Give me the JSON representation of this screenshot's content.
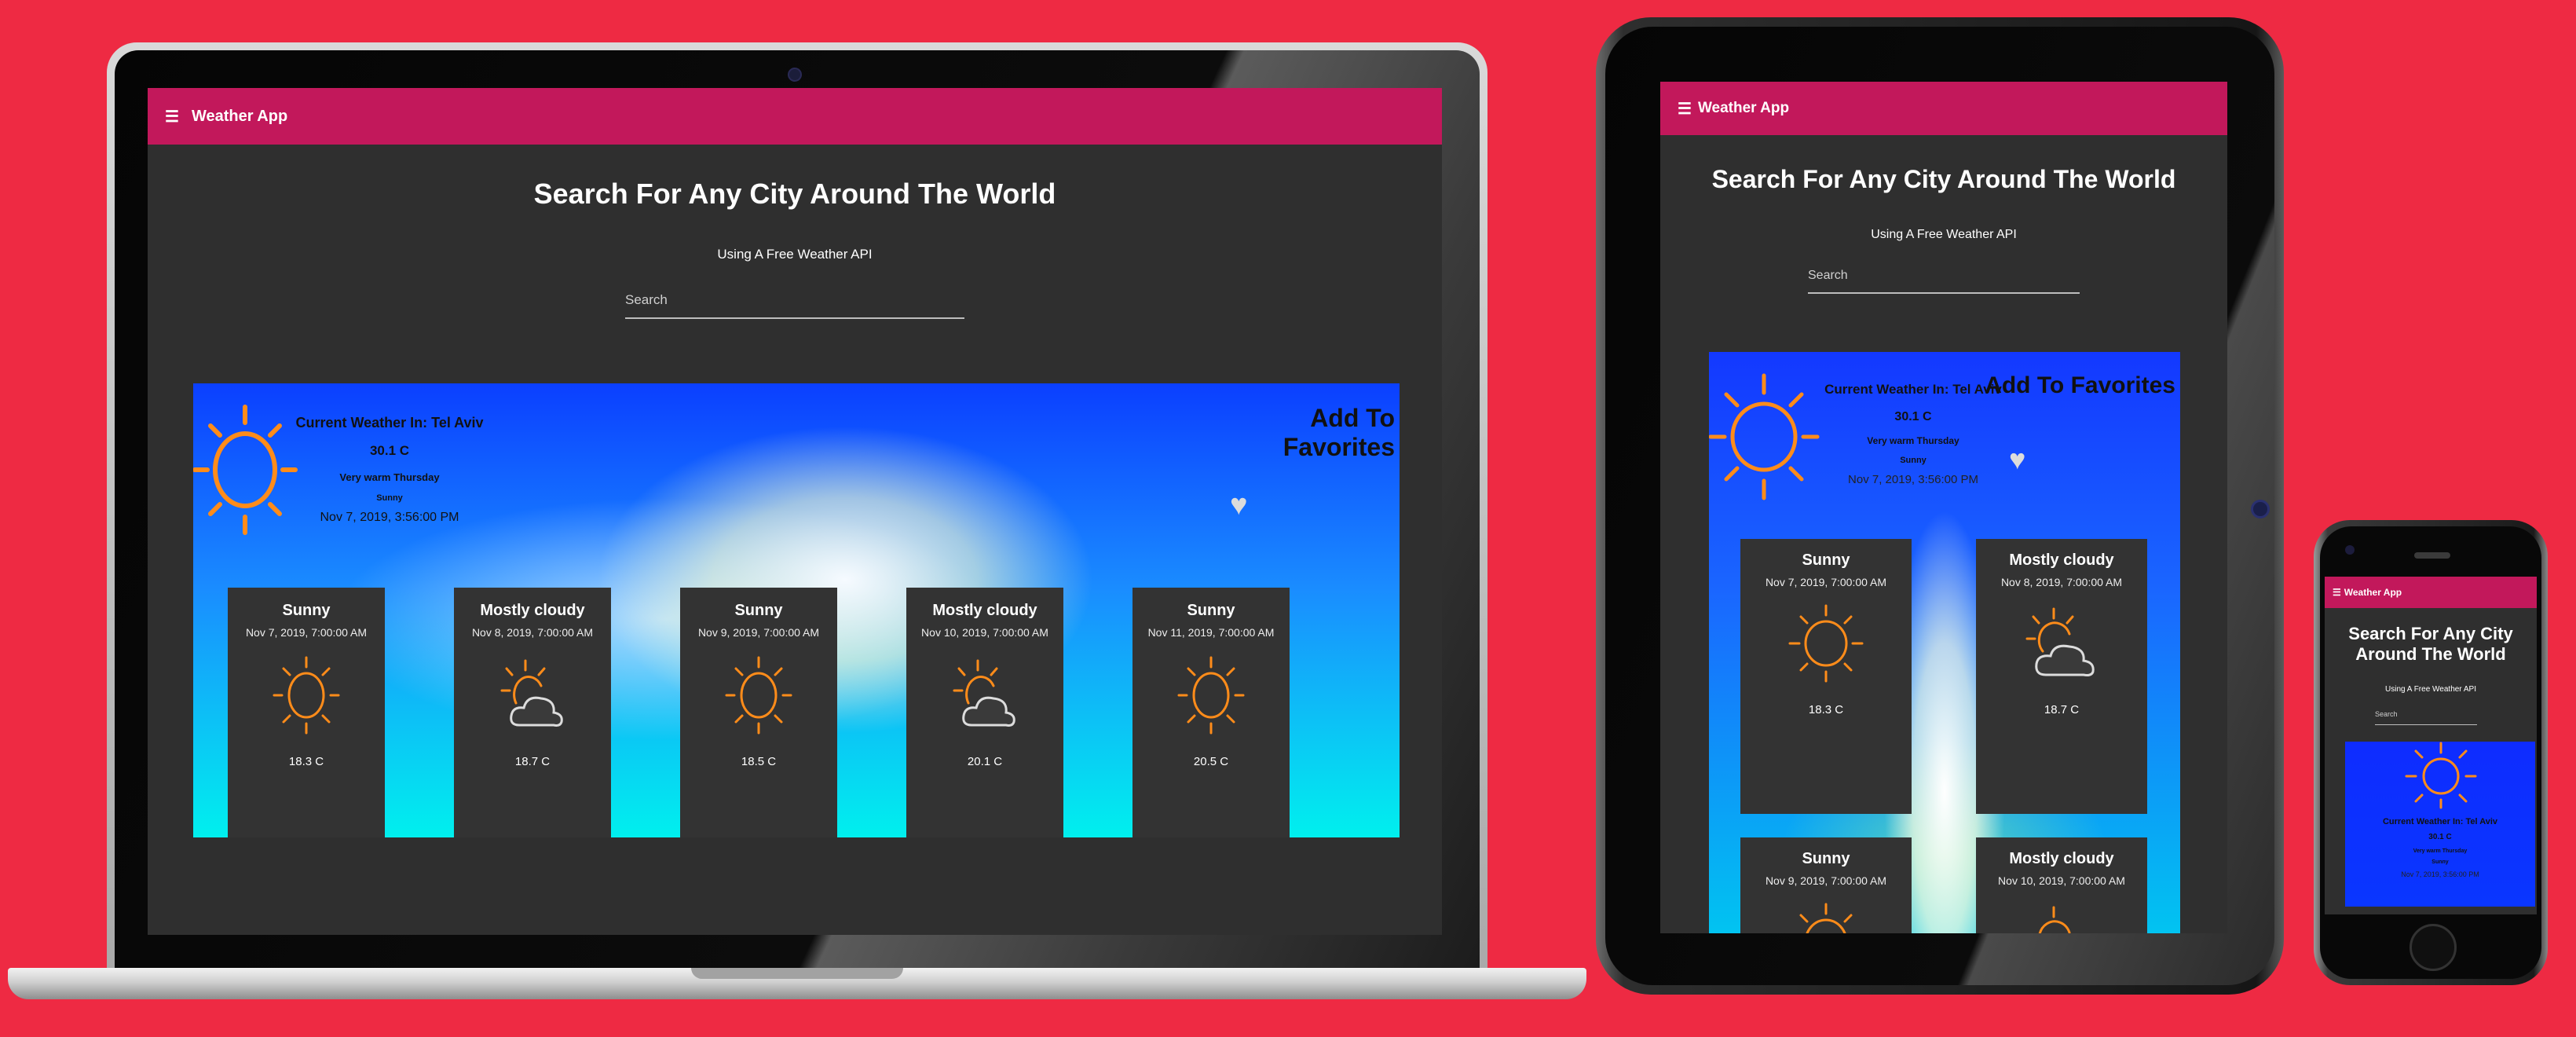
{
  "app": {
    "title": "Weather App",
    "headline": "Search For Any City Around The World",
    "subtitle": "Using A Free Weather API",
    "search_placeholder": "Search",
    "phone_headline_line1": "Search For Any City",
    "phone_headline_line2": "Around The World",
    "phone_search_value": "Search"
  },
  "current": {
    "location_label": "Current Weather In: Tel Aviv",
    "temperature": "30.1 C",
    "description": "Very warm Thursday",
    "condition": "Sunny",
    "timestamp": "Nov 7, 2019, 3:56:00 PM",
    "favorites_label": "Add To Favorites"
  },
  "forecast": [
    {
      "condition": "Sunny",
      "date": "Nov 7, 2019, 7:00:00 AM",
      "temp": "18.3 C",
      "icon": "sun-icon"
    },
    {
      "condition": "Mostly cloudy",
      "date": "Nov 8, 2019, 7:00:00 AM",
      "temp": "18.7 C",
      "icon": "partly-cloudy-icon"
    },
    {
      "condition": "Sunny",
      "date": "Nov 9, 2019, 7:00:00 AM",
      "temp": "18.5 C",
      "icon": "sun-icon"
    },
    {
      "condition": "Mostly cloudy",
      "date": "Nov 10, 2019, 7:00:00 AM",
      "temp": "20.1 C",
      "icon": "partly-cloudy-icon"
    },
    {
      "condition": "Sunny",
      "date": "Nov 11, 2019, 7:00:00 AM",
      "temp": "20.5 C",
      "icon": "sun-icon"
    }
  ],
  "colors": {
    "background": "#ee2a43",
    "appbar": "#c2185b",
    "page": "#2f2f2f",
    "card": "#333333",
    "sun": "#ff8c1a",
    "sky_top": "#0b3fff",
    "sky_bottom": "#00f0ee"
  },
  "icons": {
    "menu": "hamburger-menu-icon",
    "favorite": "heart-icon",
    "sunny": "sun-icon",
    "cloudy": "partly-cloudy-icon"
  }
}
